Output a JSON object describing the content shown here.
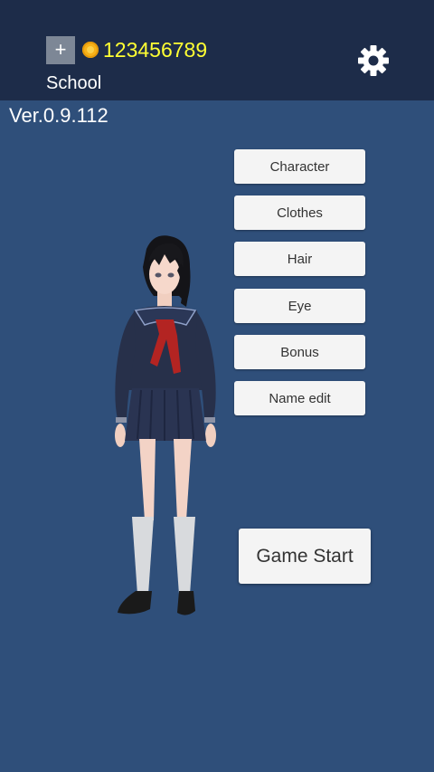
{
  "header": {
    "add_label": "+",
    "coins": "123456789",
    "location": "School",
    "settings_icon": "gear-icon",
    "coin_icon": "coin-icon"
  },
  "version": "Ver.0.9.112",
  "menu": {
    "items": [
      {
        "label": "Character"
      },
      {
        "label": "Clothes"
      },
      {
        "label": "Hair"
      },
      {
        "label": "Eye"
      },
      {
        "label": "Bonus"
      },
      {
        "label": "Name edit"
      }
    ]
  },
  "start_button": "Game Start",
  "colors": {
    "background": "#2f4f7a",
    "header_bar": "#1d2c49",
    "coin_text": "#ffff33",
    "button_bg": "#f4f4f4"
  }
}
